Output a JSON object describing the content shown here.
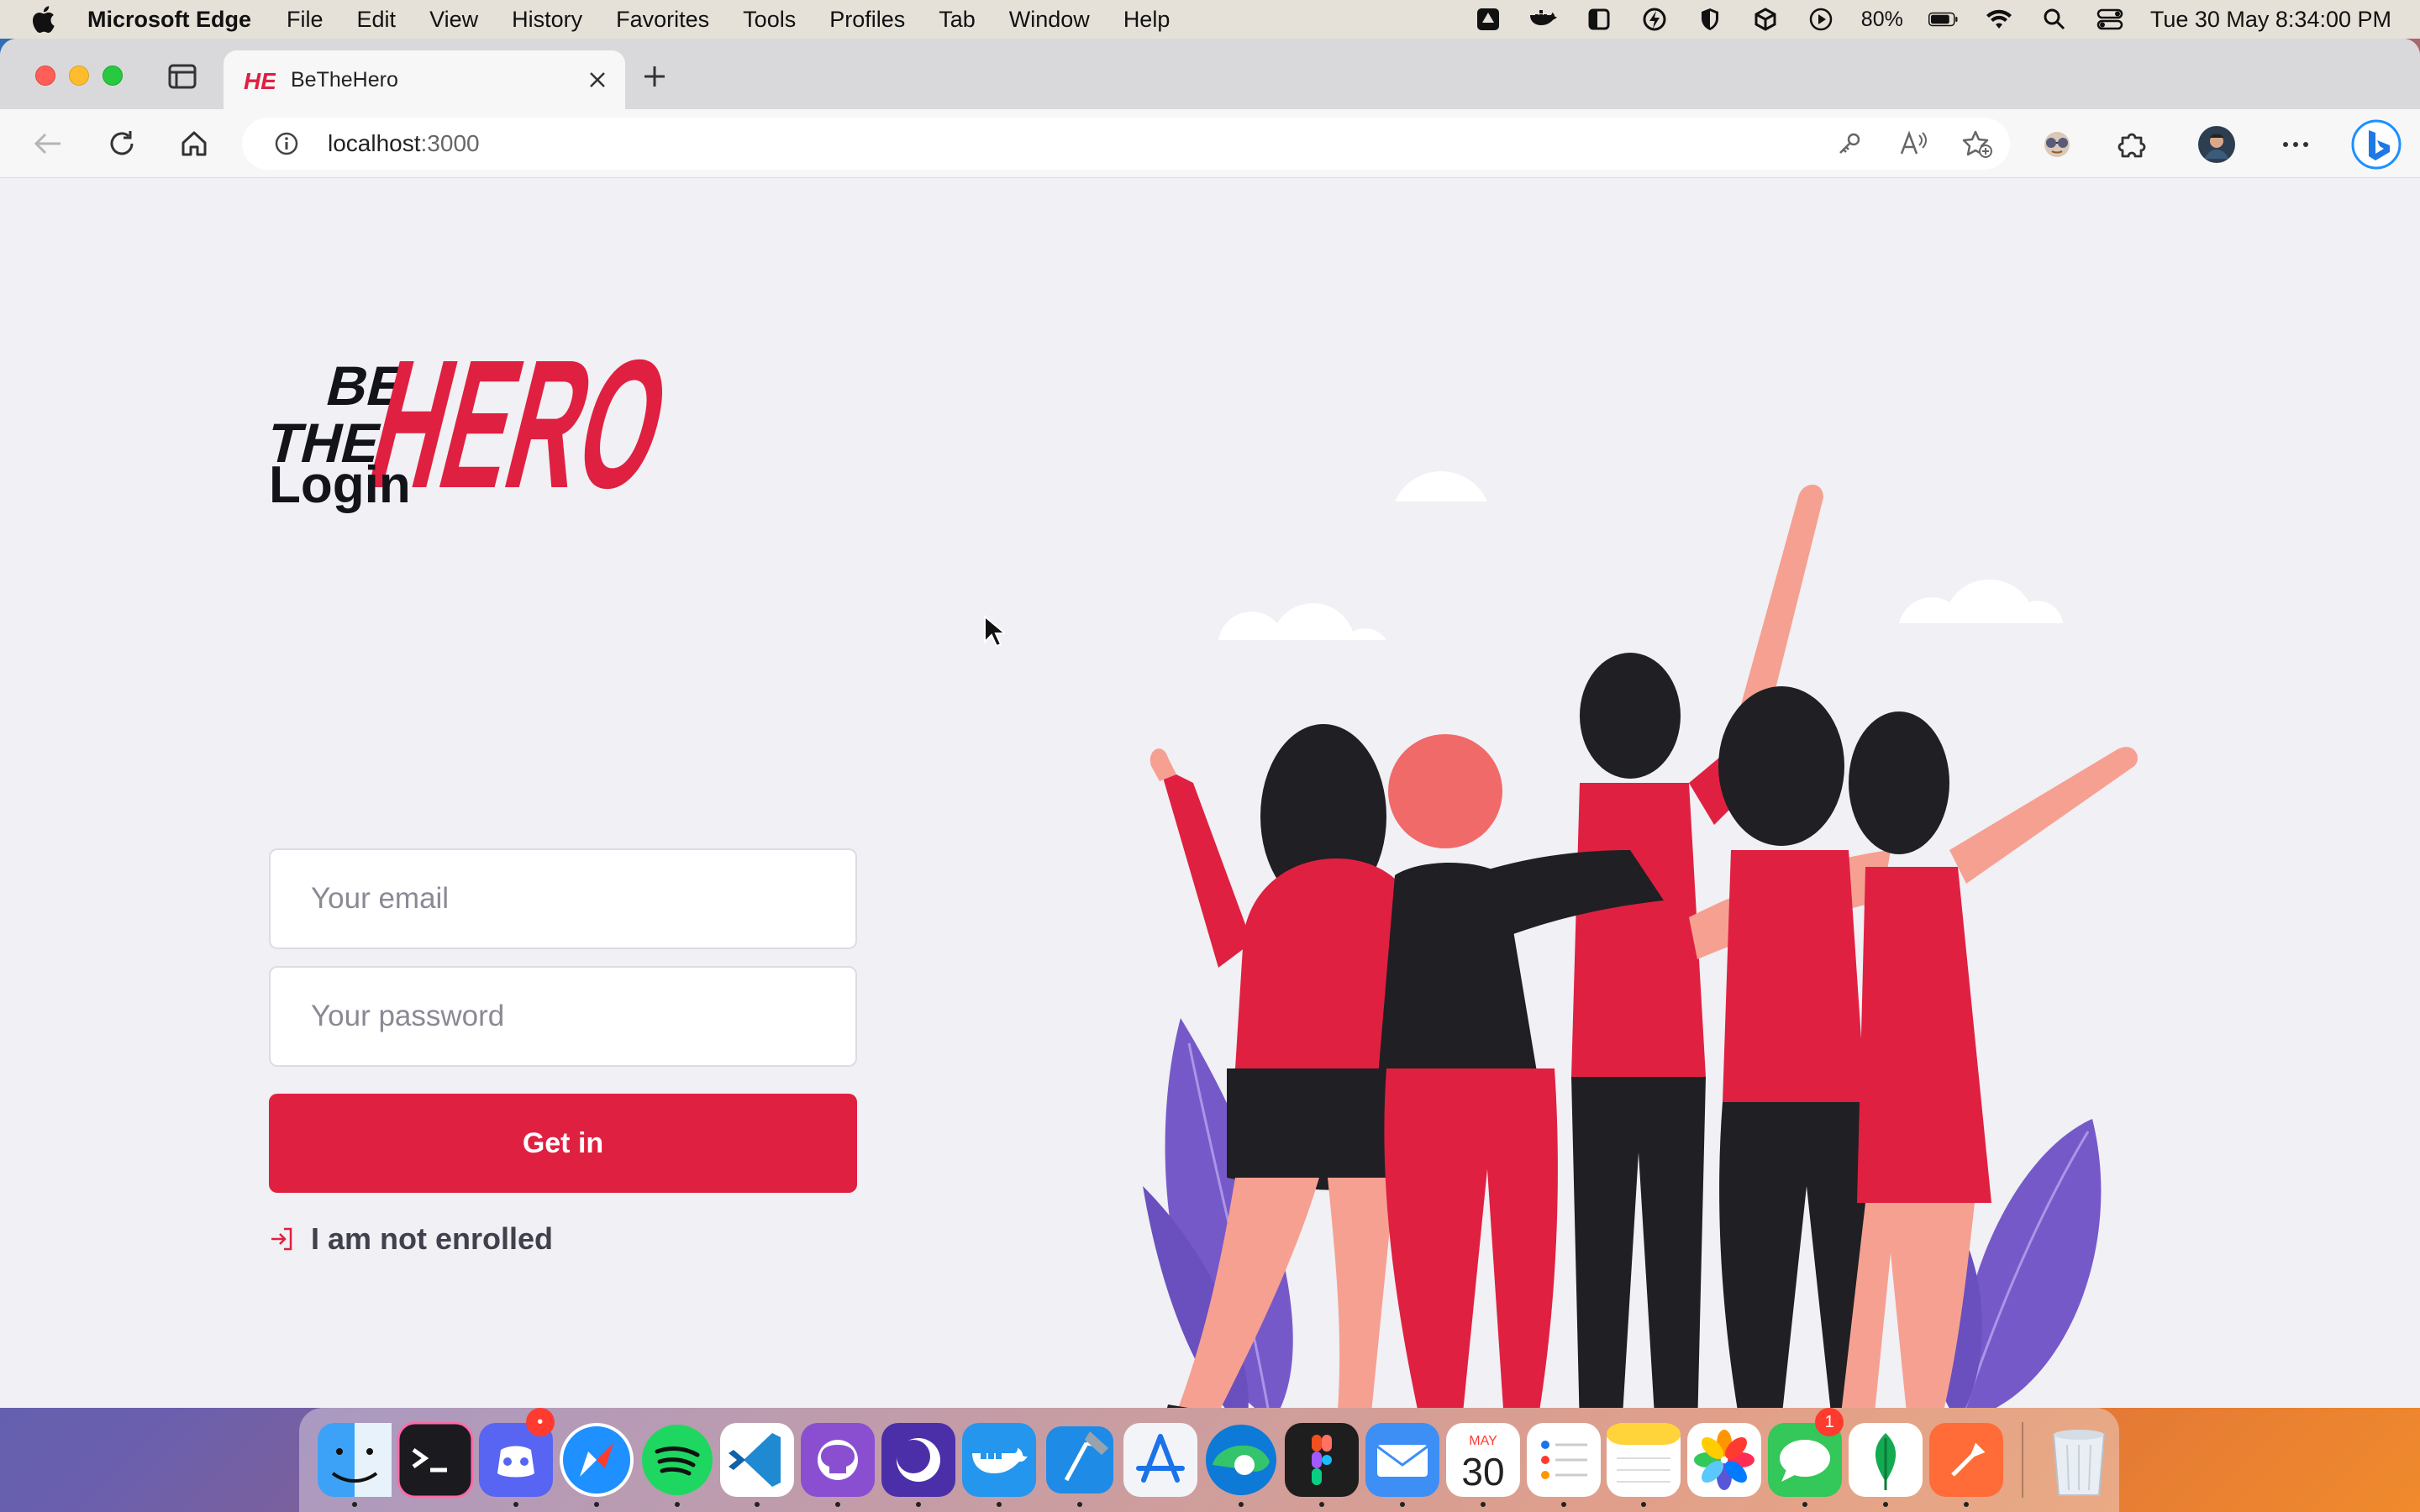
{
  "menubar": {
    "app_name": "Microsoft Edge",
    "items": [
      "File",
      "Edit",
      "View",
      "History",
      "Favorites",
      "Tools",
      "Profiles",
      "Tab",
      "Window",
      "Help"
    ],
    "battery_percent": "80%",
    "clock": "Tue 30 May  8:34:00 PM"
  },
  "browser": {
    "tab_title": "BeTheHero",
    "url_host": "localhost",
    "url_port": ":3000"
  },
  "page": {
    "logo_text_small_1": "BE",
    "logo_text_small_2": "THE",
    "logo_text_big": "HERO",
    "login_title": "Login",
    "email_placeholder": "Your email",
    "password_placeholder": "Your password",
    "submit_label": "Get in",
    "enroll_link": "I am not enrolled",
    "brand_color": "#e02041"
  },
  "dock": {
    "apps": [
      "finder",
      "terminal",
      "discord",
      "safari",
      "spotify",
      "vscode",
      "github-desktop",
      "proton-vpn",
      "docker",
      "xcode",
      "app-store",
      "edge",
      "figma",
      "mail",
      "calendar",
      "reminders",
      "notes",
      "photos",
      "messages",
      "mongodb-compass",
      "postman",
      "trash"
    ],
    "calendar_month": "MAY",
    "calendar_day": "30",
    "messages_badge": "1"
  }
}
